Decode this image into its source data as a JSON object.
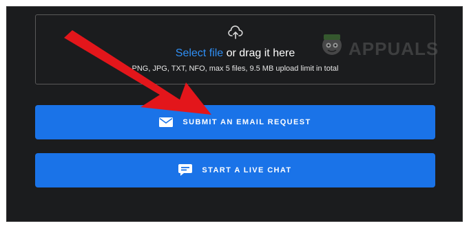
{
  "upload": {
    "select_link": "Select file",
    "drag_text": " or drag it here",
    "hint": "PNG, JPG, TXT, NFO, max 5 files, 9.5 MB upload limit in total"
  },
  "buttons": {
    "email_label": "SUBMIT AN EMAIL REQUEST",
    "chat_label": "START A LIVE CHAT"
  },
  "watermark": {
    "text": "APPUALS"
  },
  "colors": {
    "panel_bg": "#1b1c1e",
    "accent": "#1a73e8",
    "link": "#2f8ff5",
    "annotation_arrow": "#e3161b"
  },
  "icons": [
    "upload-cloud-icon",
    "envelope-icon",
    "chat-bubble-icon",
    "red-arrow-annotation"
  ]
}
